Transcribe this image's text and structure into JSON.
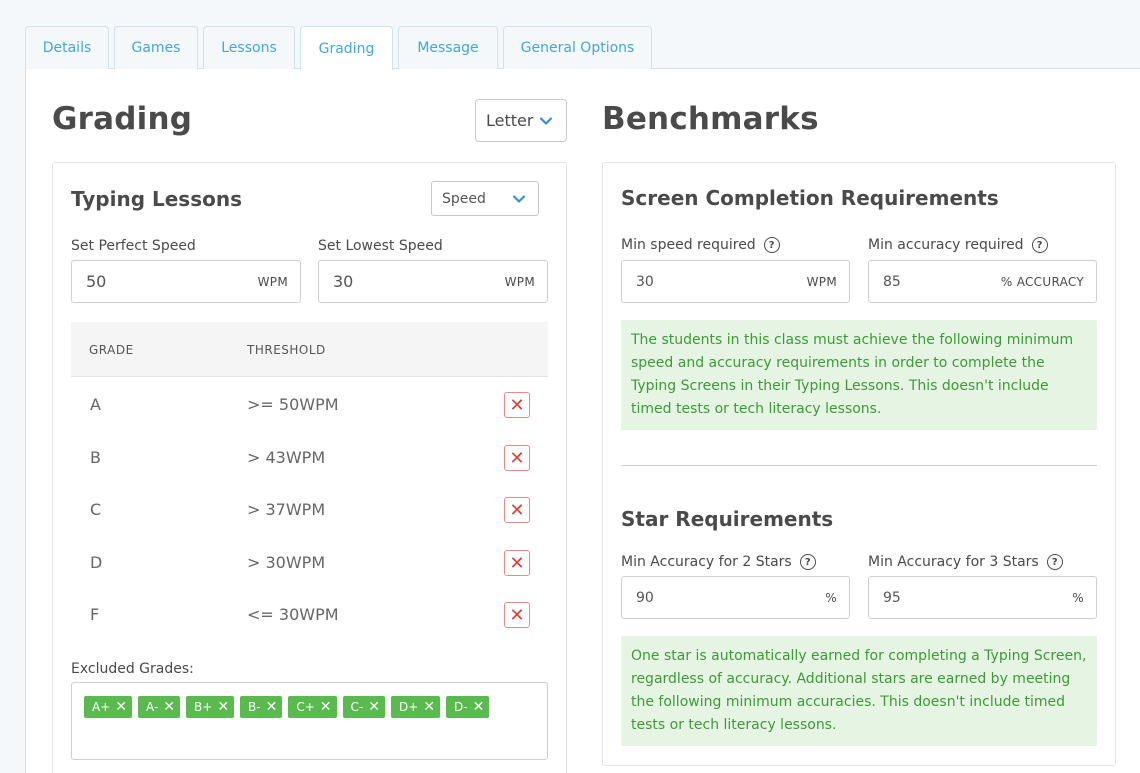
{
  "tabs": [
    {
      "label": "Details"
    },
    {
      "label": "Games"
    },
    {
      "label": "Lessons"
    },
    {
      "label": "Grading"
    },
    {
      "label": "Message"
    },
    {
      "label": "General Options"
    }
  ],
  "grading": {
    "title": "Grading",
    "scale_select": "Letter",
    "typing_lessons": {
      "title": "Typing Lessons",
      "metric_select": "Speed",
      "perfect_speed": {
        "label": "Set Perfect Speed",
        "value": "50",
        "unit": "WPM"
      },
      "lowest_speed": {
        "label": "Set Lowest Speed",
        "value": "30",
        "unit": "WPM"
      },
      "table": {
        "headers": [
          "GRADE",
          "THRESHOLD"
        ],
        "rows": [
          {
            "grade": "A",
            "threshold": ">= 50WPM"
          },
          {
            "grade": "B",
            "threshold": "> 43WPM"
          },
          {
            "grade": "C",
            "threshold": "> 37WPM"
          },
          {
            "grade": "D",
            "threshold": "> 30WPM"
          },
          {
            "grade": "F",
            "threshold": "<= 30WPM"
          }
        ]
      },
      "excluded_label": "Excluded Grades:",
      "excluded_grades": [
        "A+",
        "A-",
        "B+",
        "B-",
        "C+",
        "C-",
        "D+",
        "D-"
      ]
    }
  },
  "benchmarks": {
    "title": "Benchmarks",
    "screen_completion": {
      "title": "Screen Completion Requirements",
      "min_speed": {
        "label": "Min speed required",
        "value": "30",
        "unit": "WPM"
      },
      "min_accuracy": {
        "label": "Min accuracy required",
        "value": "85",
        "unit": "% ACCURACY"
      },
      "note": "The students in this class must achieve the following minimum speed and accuracy requirements in order to complete the Typing Screens in their Typing Lessons. This doesn't include timed tests or tech literacy lessons."
    },
    "star_requirements": {
      "title": "Star Requirements",
      "two_stars": {
        "label": "Min Accuracy for 2 Stars",
        "value": "90",
        "unit": "%"
      },
      "three_stars": {
        "label": "Min Accuracy for 3 Stars",
        "value": "95",
        "unit": "%"
      },
      "note": "One star is automatically earned for completing a Typing Screen, regardless of accuracy. Additional stars are earned by meeting the following minimum accuracies. This doesn't include timed tests or tech literacy lessons."
    }
  },
  "colors": {
    "tab_text": "#45a7db",
    "chip_green": "#5ab94f",
    "note_bg": "#e5f4e3",
    "note_text": "#3e9a38",
    "delete_red": "#d9413c"
  },
  "icons": {
    "chevron": "chevron-down-icon",
    "delete": "close-icon",
    "help": "question-circle-icon"
  }
}
